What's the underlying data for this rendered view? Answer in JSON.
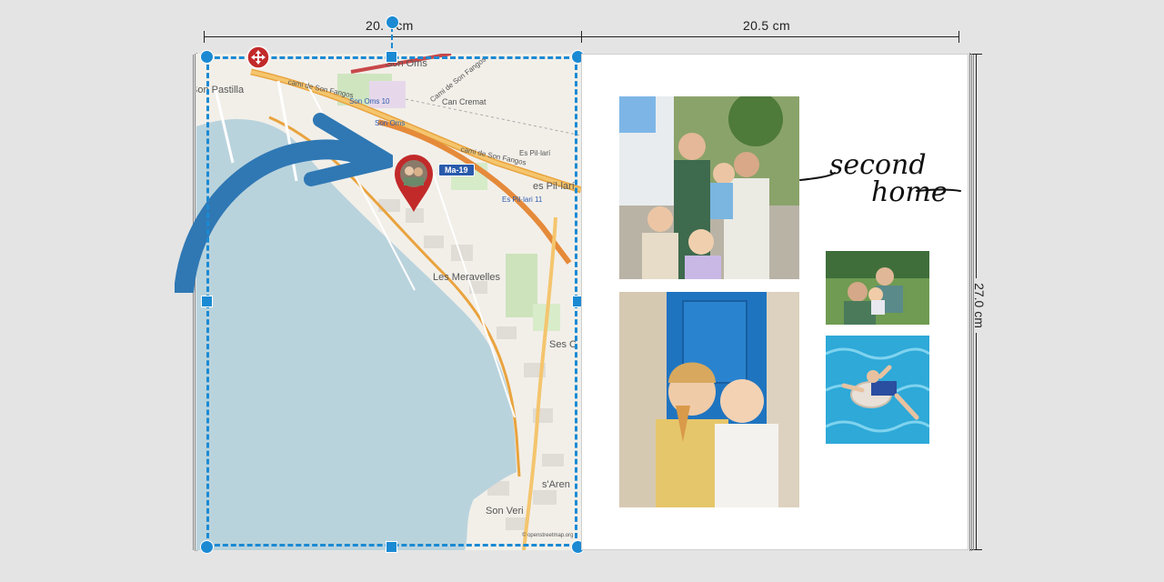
{
  "dimensions": {
    "width_left": "20.",
    "width_left_suffix": "cm",
    "width_right": "20.5 cm",
    "height": "27.0 cm"
  },
  "map": {
    "places": [
      "Son Oms",
      "Son Pastilla",
      "Can Cremat",
      "Cami de Son Fangos",
      "cami de Son Fangos",
      "Es Pil·larí",
      "es Pil·larí",
      "Les Meravelles",
      "Ses C",
      "s'Aren",
      "Son Veri"
    ],
    "stations": [
      "Son Oms 10",
      "Son Oms",
      "Es Pil·lari 11"
    ],
    "road_badge": "Ma-19",
    "attribution": "© openstreetmap.org"
  },
  "decor": {
    "caption_line1": "second",
    "caption_line2": "home"
  },
  "colors": {
    "selection": "#1b8ad3",
    "sea": "#b9d3dd",
    "land": "#f2efe9",
    "road_major": "#e9a33e",
    "arrow": "#2f78b4",
    "pin": "#c22a2a"
  },
  "icons": [
    "move-icon",
    "map-pin-icon"
  ]
}
